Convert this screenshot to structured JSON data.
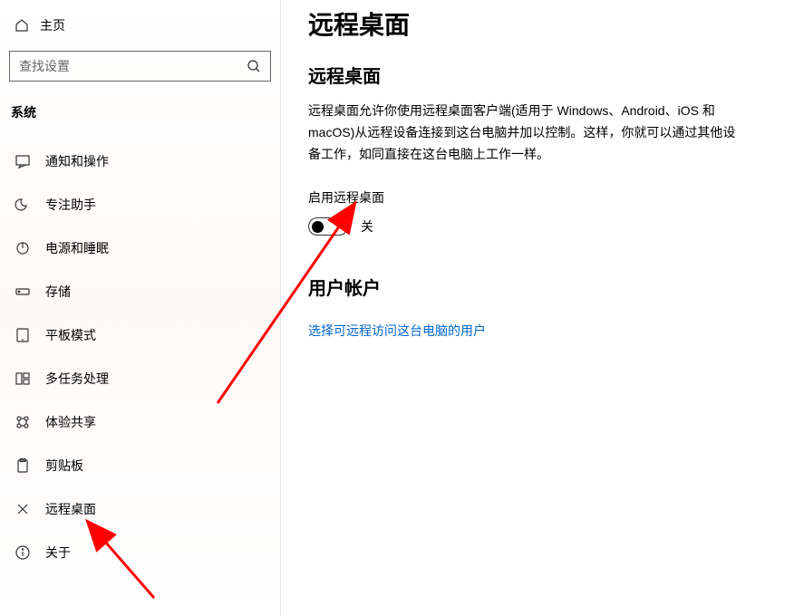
{
  "sidebar": {
    "home_label": "主页",
    "search_placeholder": "查找设置",
    "category": "系统",
    "items": [
      {
        "label": "通知和操作",
        "icon": "notification"
      },
      {
        "label": "专注助手",
        "icon": "moon"
      },
      {
        "label": "电源和睡眠",
        "icon": "power"
      },
      {
        "label": "存储",
        "icon": "storage"
      },
      {
        "label": "平板模式",
        "icon": "tablet"
      },
      {
        "label": "多任务处理",
        "icon": "multitask"
      },
      {
        "label": "体验共享",
        "icon": "share"
      },
      {
        "label": "剪贴板",
        "icon": "clipboard"
      },
      {
        "label": "远程桌面",
        "icon": "remote"
      },
      {
        "label": "关于",
        "icon": "about"
      }
    ]
  },
  "main": {
    "page_title": "远程桌面",
    "section1_title": "远程桌面",
    "description": "远程桌面允许你使用远程桌面客户端(适用于 Windows、Android、iOS 和 macOS)从远程设备连接到这台电脑并加以控制。这样，你就可以通过其他设备工作，如同直接在这台电脑上工作一样。",
    "toggle_label": "启用远程桌面",
    "toggle_state": "关",
    "section2_title": "用户帐户",
    "link_text": "选择可远程访问这台电脑的用户"
  }
}
